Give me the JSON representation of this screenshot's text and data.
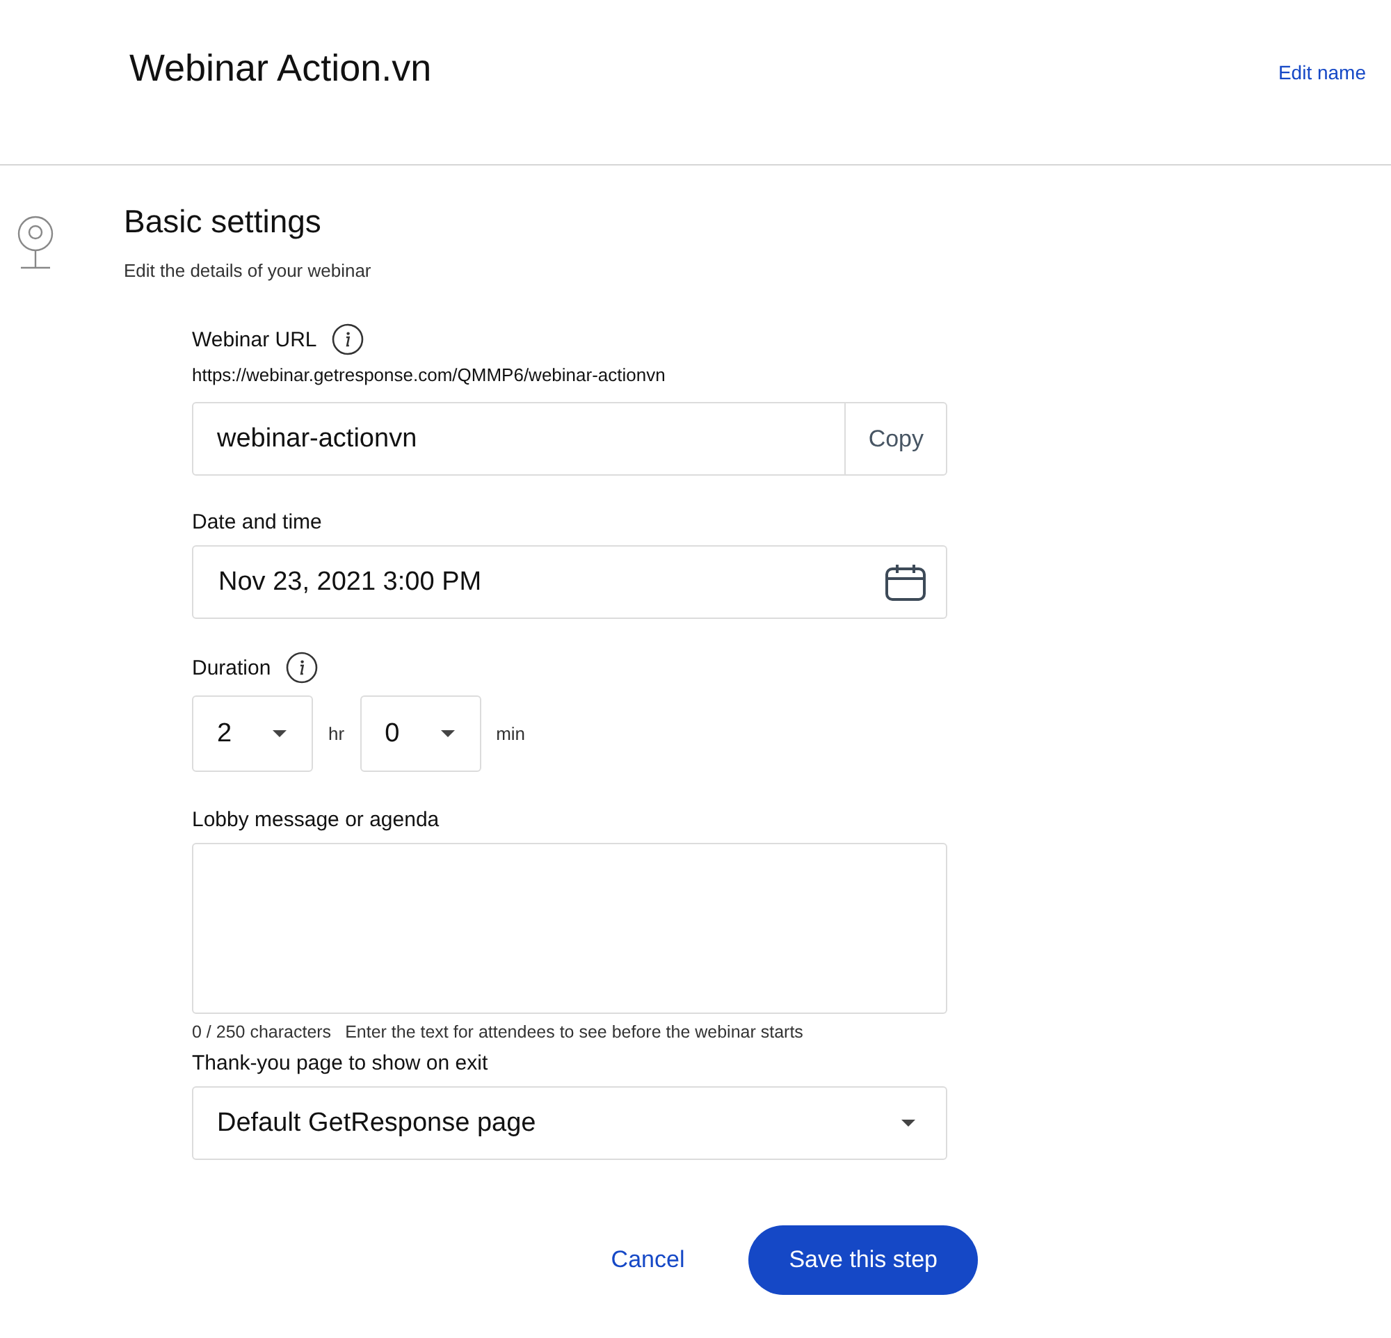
{
  "header": {
    "title": "Webinar Action.vn",
    "edit_link": "Edit name"
  },
  "section": {
    "title": "Basic settings",
    "subtitle": "Edit the details of your webinar"
  },
  "url_field": {
    "label": "Webinar URL",
    "full_url": "https://webinar.getresponse.com/QMMP6/webinar-actionvn",
    "value": "webinar-actionvn",
    "copy_button": "Copy"
  },
  "date_field": {
    "label": "Date and time",
    "value": "Nov 23, 2021 3:00 PM"
  },
  "duration": {
    "label": "Duration",
    "hours": "2",
    "hours_unit": "hr",
    "minutes": "0",
    "minutes_unit": "min"
  },
  "lobby": {
    "label": "Lobby message or agenda",
    "counter": "0 / 250 characters",
    "hint": "Enter the text for attendees to see before the webinar starts"
  },
  "thank_you": {
    "label": "Thank-you page to show on exit",
    "value": "Default GetResponse page"
  },
  "buttons": {
    "cancel": "Cancel",
    "save": "Save this step"
  }
}
